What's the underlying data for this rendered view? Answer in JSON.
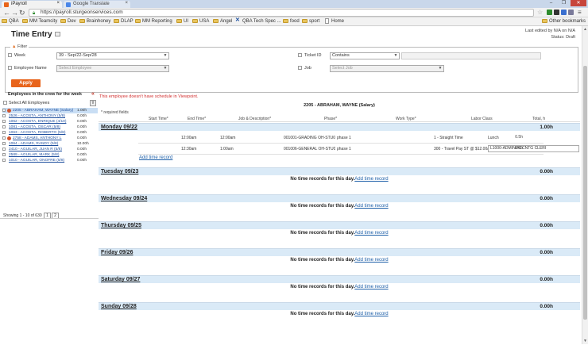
{
  "browser": {
    "tabs": [
      {
        "title": "iPayroll",
        "active": true,
        "favicon_color": "#e8641b"
      },
      {
        "title": "Google Translate",
        "active": false,
        "favicon_color": "#4a86e8"
      }
    ],
    "url": "https://payroll.sturgeonservices.com",
    "bookmarks": [
      {
        "label": "QBA",
        "type": "folder"
      },
      {
        "label": "MM Teamcity",
        "type": "folder"
      },
      {
        "label": "Dev",
        "type": "folder"
      },
      {
        "label": "Brainhoney",
        "type": "folder"
      },
      {
        "label": "DLAP",
        "type": "folder"
      },
      {
        "label": "MM Reporting",
        "type": "folder"
      },
      {
        "label": "UI",
        "type": "folder"
      },
      {
        "label": "USA",
        "type": "folder"
      },
      {
        "label": "Angel",
        "type": "folder"
      },
      {
        "label": "QBA Tech Spec ...",
        "type": "jira"
      },
      {
        "label": "food",
        "type": "folder"
      },
      {
        "label": "sport",
        "type": "folder"
      },
      {
        "label": "Home",
        "type": "page"
      }
    ],
    "other_bookmarks": "Other bookmarks"
  },
  "page": {
    "title": "Time Entry",
    "last_edited": "Last edited by N/A on N/A",
    "status": "Status: Draft"
  },
  "filter": {
    "legend": "Filter",
    "week_label": "Week",
    "week_value": "39 - Sep/22-Sep/28",
    "employee_label": "Employee Name",
    "employee_placeholder": "Select Employee",
    "ticket_label": "Ticket ID",
    "ticket_operator": "Contains",
    "job_label": "Job",
    "job_placeholder": "Select Job",
    "apply_label": "Apply"
  },
  "crew": {
    "title": "Employees in the crew for the week",
    "select_all": "Select All Employees",
    "employees": [
      {
        "name": "2205 - ABRAHAM, WAYNE (Salary)",
        "hours": "1.00h",
        "selected": true,
        "warn": true
      },
      {
        "name": "2526 - ACOSTA, ANTHONY (5/8)",
        "hours": "0.00h",
        "selected": false,
        "warn": false
      },
      {
        "name": "1062 - ACOSTA, ENRIQUE (4/10)",
        "hours": "0.00h",
        "selected": false,
        "warn": false
      },
      {
        "name": "1081 - ACOSTA, OSCAR (5/8)",
        "hours": "0.00h",
        "selected": false,
        "warn": false
      },
      {
        "name": "1063 - ACOSTA, ROBERTO (5/8)",
        "hours": "0.00h",
        "selected": false,
        "warn": false
      },
      {
        "name": "2758 - ADAMS, ANTHONY L",
        "hours": "0.00h",
        "selected": false,
        "warn": true
      },
      {
        "name": "1064 - ADAMS, RANDY (5/8)",
        "hours": "10.00h",
        "selected": false,
        "warn": false
      },
      {
        "name": "2410 - AGUILAR, JUAN R (5/8)",
        "hours": "0.00h",
        "selected": false,
        "warn": false
      },
      {
        "name": "2589 - AGUILAR, MARK (5/8)",
        "hours": "0.00h",
        "selected": false,
        "warn": false
      },
      {
        "name": "1010 - AGUILAR, ONOFRE (5/8)",
        "hours": "0.00h",
        "selected": false,
        "warn": false
      }
    ],
    "paging_text": "Showing 1 - 10 of 630",
    "pages": [
      "1",
      "2"
    ]
  },
  "main": {
    "warning": "This employee doesn't have schedule in Viewpoint.",
    "employee_header": "2205 - ABRAHAM, WAYNE (Salary)",
    "required_note": "* required fields",
    "columns": [
      "Start Time*",
      "End Time*",
      "Job & Description*",
      "Phase*",
      "Work Type*",
      "Labor Class",
      "Total, h"
    ],
    "no_records_msg": "No time records for this day.",
    "add_record": "Add time record",
    "days": [
      {
        "name": "Monday 09/22",
        "total": "1.00h",
        "records": [
          {
            "start": "12:00am",
            "end": "12:00am",
            "job": "001001-GRADING OH-STU070...",
            "phase": "phase 1",
            "work_type": "1 - Straight Time",
            "labor_class": "Lunch",
            "total": "0.5h",
            "labor_select": false
          },
          {
            "start": "12:30am",
            "end": "1:00am",
            "job": "001006-GENERAL OH-STU070...",
            "phase": "phase 1",
            "work_type": "300 - Travel Pay ST @ $12.00/hr",
            "labor_class": "L1000-ADMIN/ACCNTG CLERI",
            "total": "0.5h",
            "labor_select": true
          }
        ]
      },
      {
        "name": "Tuesday 09/23",
        "total": "0.00h",
        "records": []
      },
      {
        "name": "Wednesday 09/24",
        "total": "0.00h",
        "records": []
      },
      {
        "name": "Thursday 09/25",
        "total": "0.00h",
        "records": []
      },
      {
        "name": "Friday 09/26",
        "total": "0.00h",
        "records": []
      },
      {
        "name": "Saturday 09/27",
        "total": "0.00h",
        "records": []
      },
      {
        "name": "Sunday 09/28",
        "total": "0.00h",
        "records": []
      }
    ]
  }
}
